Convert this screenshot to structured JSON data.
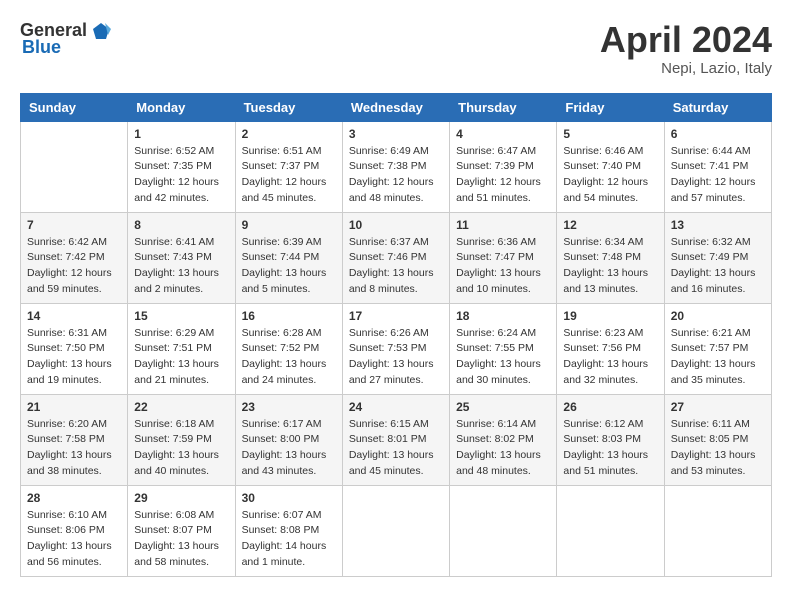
{
  "header": {
    "logo_general": "General",
    "logo_blue": "Blue",
    "month_title": "April 2024",
    "location": "Nepi, Lazio, Italy"
  },
  "days_of_week": [
    "Sunday",
    "Monday",
    "Tuesday",
    "Wednesday",
    "Thursday",
    "Friday",
    "Saturday"
  ],
  "weeks": [
    [
      {
        "day": "",
        "info": ""
      },
      {
        "day": "1",
        "info": "Sunrise: 6:52 AM\nSunset: 7:35 PM\nDaylight: 12 hours\nand 42 minutes."
      },
      {
        "day": "2",
        "info": "Sunrise: 6:51 AM\nSunset: 7:37 PM\nDaylight: 12 hours\nand 45 minutes."
      },
      {
        "day": "3",
        "info": "Sunrise: 6:49 AM\nSunset: 7:38 PM\nDaylight: 12 hours\nand 48 minutes."
      },
      {
        "day": "4",
        "info": "Sunrise: 6:47 AM\nSunset: 7:39 PM\nDaylight: 12 hours\nand 51 minutes."
      },
      {
        "day": "5",
        "info": "Sunrise: 6:46 AM\nSunset: 7:40 PM\nDaylight: 12 hours\nand 54 minutes."
      },
      {
        "day": "6",
        "info": "Sunrise: 6:44 AM\nSunset: 7:41 PM\nDaylight: 12 hours\nand 57 minutes."
      }
    ],
    [
      {
        "day": "7",
        "info": "Sunrise: 6:42 AM\nSunset: 7:42 PM\nDaylight: 12 hours\nand 59 minutes."
      },
      {
        "day": "8",
        "info": "Sunrise: 6:41 AM\nSunset: 7:43 PM\nDaylight: 13 hours\nand 2 minutes."
      },
      {
        "day": "9",
        "info": "Sunrise: 6:39 AM\nSunset: 7:44 PM\nDaylight: 13 hours\nand 5 minutes."
      },
      {
        "day": "10",
        "info": "Sunrise: 6:37 AM\nSunset: 7:46 PM\nDaylight: 13 hours\nand 8 minutes."
      },
      {
        "day": "11",
        "info": "Sunrise: 6:36 AM\nSunset: 7:47 PM\nDaylight: 13 hours\nand 10 minutes."
      },
      {
        "day": "12",
        "info": "Sunrise: 6:34 AM\nSunset: 7:48 PM\nDaylight: 13 hours\nand 13 minutes."
      },
      {
        "day": "13",
        "info": "Sunrise: 6:32 AM\nSunset: 7:49 PM\nDaylight: 13 hours\nand 16 minutes."
      }
    ],
    [
      {
        "day": "14",
        "info": "Sunrise: 6:31 AM\nSunset: 7:50 PM\nDaylight: 13 hours\nand 19 minutes."
      },
      {
        "day": "15",
        "info": "Sunrise: 6:29 AM\nSunset: 7:51 PM\nDaylight: 13 hours\nand 21 minutes."
      },
      {
        "day": "16",
        "info": "Sunrise: 6:28 AM\nSunset: 7:52 PM\nDaylight: 13 hours\nand 24 minutes."
      },
      {
        "day": "17",
        "info": "Sunrise: 6:26 AM\nSunset: 7:53 PM\nDaylight: 13 hours\nand 27 minutes."
      },
      {
        "day": "18",
        "info": "Sunrise: 6:24 AM\nSunset: 7:55 PM\nDaylight: 13 hours\nand 30 minutes."
      },
      {
        "day": "19",
        "info": "Sunrise: 6:23 AM\nSunset: 7:56 PM\nDaylight: 13 hours\nand 32 minutes."
      },
      {
        "day": "20",
        "info": "Sunrise: 6:21 AM\nSunset: 7:57 PM\nDaylight: 13 hours\nand 35 minutes."
      }
    ],
    [
      {
        "day": "21",
        "info": "Sunrise: 6:20 AM\nSunset: 7:58 PM\nDaylight: 13 hours\nand 38 minutes."
      },
      {
        "day": "22",
        "info": "Sunrise: 6:18 AM\nSunset: 7:59 PM\nDaylight: 13 hours\nand 40 minutes."
      },
      {
        "day": "23",
        "info": "Sunrise: 6:17 AM\nSunset: 8:00 PM\nDaylight: 13 hours\nand 43 minutes."
      },
      {
        "day": "24",
        "info": "Sunrise: 6:15 AM\nSunset: 8:01 PM\nDaylight: 13 hours\nand 45 minutes."
      },
      {
        "day": "25",
        "info": "Sunrise: 6:14 AM\nSunset: 8:02 PM\nDaylight: 13 hours\nand 48 minutes."
      },
      {
        "day": "26",
        "info": "Sunrise: 6:12 AM\nSunset: 8:03 PM\nDaylight: 13 hours\nand 51 minutes."
      },
      {
        "day": "27",
        "info": "Sunrise: 6:11 AM\nSunset: 8:05 PM\nDaylight: 13 hours\nand 53 minutes."
      }
    ],
    [
      {
        "day": "28",
        "info": "Sunrise: 6:10 AM\nSunset: 8:06 PM\nDaylight: 13 hours\nand 56 minutes."
      },
      {
        "day": "29",
        "info": "Sunrise: 6:08 AM\nSunset: 8:07 PM\nDaylight: 13 hours\nand 58 minutes."
      },
      {
        "day": "30",
        "info": "Sunrise: 6:07 AM\nSunset: 8:08 PM\nDaylight: 14 hours\nand 1 minute."
      },
      {
        "day": "",
        "info": ""
      },
      {
        "day": "",
        "info": ""
      },
      {
        "day": "",
        "info": ""
      },
      {
        "day": "",
        "info": ""
      }
    ]
  ]
}
